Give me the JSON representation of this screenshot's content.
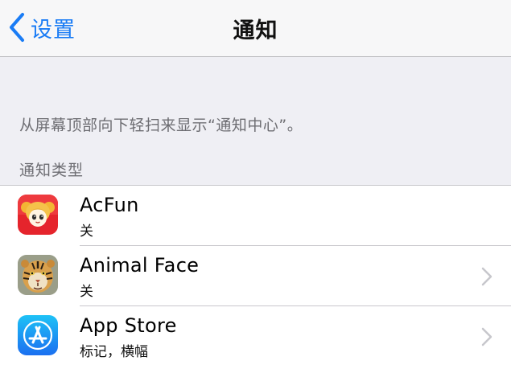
{
  "navbar": {
    "back_label": "设置",
    "title": "通知"
  },
  "hint": "从屏幕顶部向下轻扫来显示“通知中心”。",
  "section_header": "通知类型",
  "apps": [
    {
      "name": "AcFun",
      "status": "关",
      "icon": "acfun-icon",
      "has_chevron": false
    },
    {
      "name": "Animal Face",
      "status": "关",
      "icon": "tiger-icon",
      "has_chevron": true
    },
    {
      "name": "App Store",
      "status": "标记，横幅",
      "icon": "app-store-icon",
      "has_chevron": true
    }
  ],
  "colors": {
    "accent": "#1a7cf5",
    "background": "#efeff4",
    "navbar": "#f7f7f8",
    "secondary_text": "#6d6d72",
    "separator": "#c8c7cc",
    "chevron": "#c7c7cc"
  }
}
